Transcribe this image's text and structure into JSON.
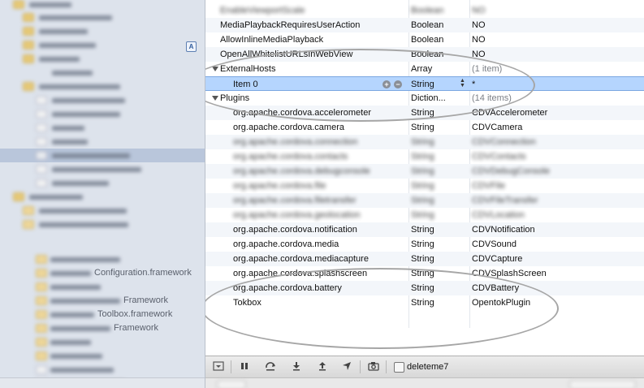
{
  "sidebar": {
    "visible_items": [
      {
        "label": "Tokbox",
        "indent": 44,
        "type": "folder"
      },
      {
        "label": "Configuration.framework",
        "indent": 44,
        "type": "framework"
      },
      {
        "label": "Framework",
        "indent": 44,
        "type": "framework"
      },
      {
        "label": "Framework",
        "indent": 44,
        "type": "framework"
      },
      {
        "label": "Toolbox.framework",
        "indent": 44,
        "type": "framework"
      },
      {
        "label": "Framework",
        "indent": 44,
        "type": "framework"
      }
    ],
    "badge": "A"
  },
  "plist": {
    "columns": [
      "Key",
      "Type",
      "Value"
    ],
    "rows": [
      {
        "key": "EnableViewportScale",
        "type": "Boolean",
        "value": "NO",
        "indent": 18,
        "blurred": true
      },
      {
        "key": "MediaPlaybackRequiresUserAction",
        "type": "Boolean",
        "value": "NO",
        "indent": 18,
        "blurred": false
      },
      {
        "key": "AllowInlineMediaPlayback",
        "type": "Boolean",
        "value": "NO",
        "indent": 18,
        "blurred": false
      },
      {
        "key": "OpenAllWhitelistURLsInWebView",
        "type": "Boolean",
        "value": "NO",
        "indent": 18,
        "blurred": false
      },
      {
        "key": "ExternalHosts",
        "type": "Array",
        "value": "(1 item)",
        "indent": 18,
        "blurred": false,
        "disclosure": true
      },
      {
        "key": "Item 0",
        "type": "String",
        "value": "*",
        "indent": 34,
        "blurred": false,
        "selected": true
      },
      {
        "key": "Plugins",
        "type": "Diction...",
        "value": "(14 items)",
        "indent": 18,
        "blurred": false,
        "disclosure": true
      },
      {
        "key": "org.apache.cordova.accelerometer",
        "type": "String",
        "value": "CDVAccelerometer",
        "indent": 34,
        "blurred": false
      },
      {
        "key": "org.apache.cordova.camera",
        "type": "String",
        "value": "CDVCamera",
        "indent": 34,
        "blurred": false
      },
      {
        "key": "org.apache.cordova.connection",
        "type": "String",
        "value": "CDVConnection",
        "indent": 34,
        "blurred": true
      },
      {
        "key": "org.apache.cordova.contacts",
        "type": "String",
        "value": "CDVContacts",
        "indent": 34,
        "blurred": true
      },
      {
        "key": "org.apache.cordova.debugconsole",
        "type": "String",
        "value": "CDVDebugConsole",
        "indent": 34,
        "blurred": true
      },
      {
        "key": "org.apache.cordova.file",
        "type": "String",
        "value": "CDVFile",
        "indent": 34,
        "blurred": true
      },
      {
        "key": "org.apache.cordova.filetransfer",
        "type": "String",
        "value": "CDVFileTransfer",
        "indent": 34,
        "blurred": true
      },
      {
        "key": "org.apache.cordova.geolocation",
        "type": "String",
        "value": "CDVLocation",
        "indent": 34,
        "blurred": true
      },
      {
        "key": "org.apache.cordova.notification",
        "type": "String",
        "value": "CDVNotification",
        "indent": 34,
        "blurred": false
      },
      {
        "key": "org.apache.cordova.media",
        "type": "String",
        "value": "CDVSound",
        "indent": 34,
        "blurred": false
      },
      {
        "key": "org.apache.cordova.mediacapture",
        "type": "String",
        "value": "CDVCapture",
        "indent": 34,
        "blurred": false
      },
      {
        "key": "org.apache.cordova.splashscreen",
        "type": "String",
        "value": "CDVSplashScreen",
        "indent": 34,
        "blurred": false
      },
      {
        "key": "org.apache.cordova.battery",
        "type": "String",
        "value": "CDVBattery",
        "indent": 34,
        "blurred": false
      },
      {
        "key": "Tokbox",
        "type": "String",
        "value": "OpentokPlugin",
        "indent": 34,
        "blurred": false
      }
    ]
  },
  "debug_bar": {
    "scheme_label": "deleteme7",
    "icons": [
      "toggle-console-icon",
      "pause-icon",
      "step-over-icon",
      "step-into-icon",
      "step-out-icon",
      "location-icon",
      "camera-icon"
    ]
  },
  "colors": {
    "selection": "#b5d5fe",
    "sidebar_bg": "#dde3ec",
    "annotation_oval": "#a6a6a6"
  }
}
